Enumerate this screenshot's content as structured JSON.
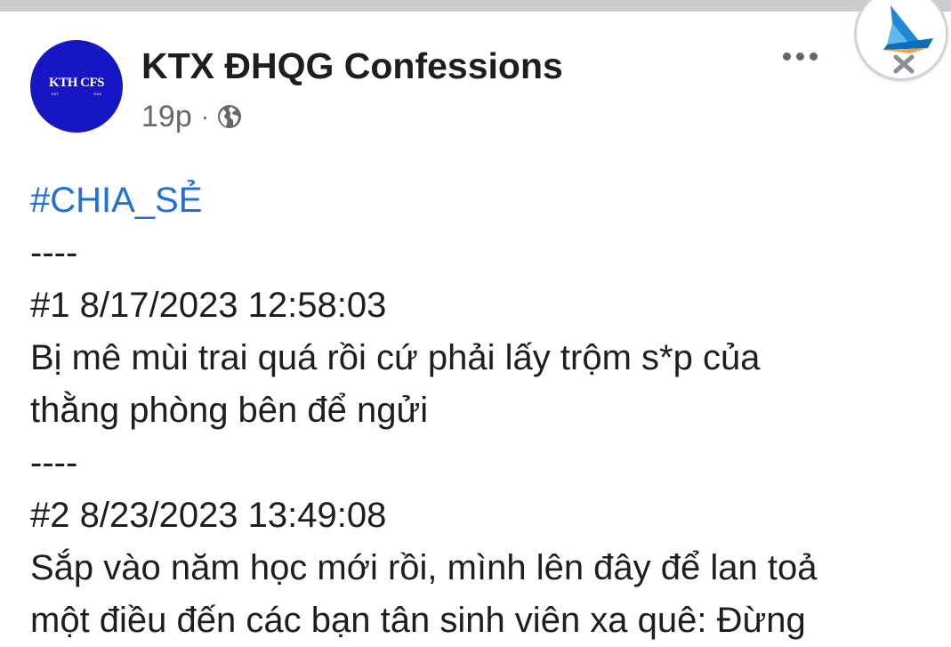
{
  "post": {
    "page_name": "KTX ĐHQG Confessions",
    "time": "19p",
    "separator": "·",
    "avatar": {
      "text": "KTH CFS",
      "sub_left": "EST",
      "sub_right": "2013",
      "color": "#1616c6"
    },
    "icons": {
      "privacy": "globe-icon",
      "more": "more-options-icon",
      "bubble": "floating-app-bubble-icon"
    }
  },
  "content": {
    "hashtag": "#CHIA_SẺ",
    "lines": [
      "----",
      "#1 8/17/2023 12:58:03",
      "Bị mê mùi trai quá rồi cứ phải lấy trộm s*p của",
      "thằng phòng bên để ngửi",
      "----",
      "#2 8/23/2023 13:49:08",
      "Sắp vào năm học mới rồi, mình lên đây để lan toả",
      "một điều đến các bạn tân sinh viên xa quê: Đừng"
    ]
  },
  "colors": {
    "hashtag": "#216fdb",
    "text": "#1c1e21",
    "meta": "#65676b",
    "topbar": "#c9ccd1"
  }
}
